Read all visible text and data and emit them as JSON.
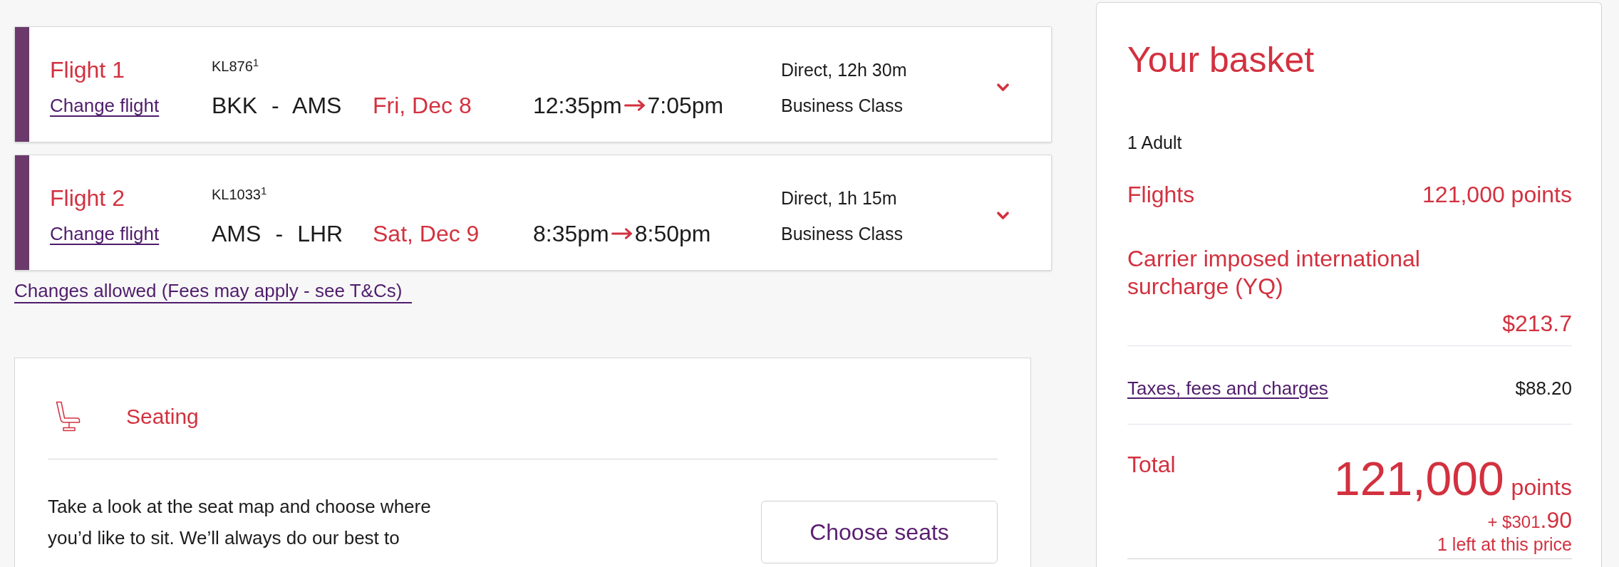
{
  "flights": [
    {
      "title": "Flight 1",
      "change_link": "Change flight",
      "flight_number": "KL876$^{1}$",
      "route": "BKK - AMS",
      "date": "Fri, Dec 8",
      "departure": "12:35pm",
      "arrival": "7:05pm",
      "duration": "Direct, 12h 30m",
      "cabin": "Business Class",
      "expanded": false
    },
    {
      "title": "Flight 2",
      "change_link": "Change flight",
      "flight_number": "KL1033$^{1}$",
      "route": "AMS - LHR",
      "date": "Sat, Dec 9",
      "departure": "8:35pm",
      "arrival": "8:50pm",
      "duration": "Direct, 1h 15m",
      "cabin": "Business Class",
      "expanded": false
    }
  ],
  "changes_link": "Changes allowed (Fees may apply - see T&Cs)",
  "seating": {
    "title": "Seating",
    "description": "Take a look at the seat map and choose where you’d like to sit. We’ll always do our best to",
    "button": "Choose seats"
  },
  "basket": {
    "title": "Your basket",
    "passengers": "1 Adult",
    "lines": [
      {
        "kind": "points",
        "label": "Flights",
        "value": "121,000 points"
      },
      {
        "kind": "surcharge",
        "label": "Carrier imposed international surcharge (YQ)",
        "value": "$213.7"
      },
      {
        "kind": "link",
        "label": "Taxes, fees and charges",
        "value": "$88.20"
      }
    ],
    "total": {
      "label": "Total",
      "points": "121,000",
      "points_unit": "points",
      "cash": "+ $301",
      "cash_cents": ".90",
      "note": "1 left at this price"
    }
  }
}
